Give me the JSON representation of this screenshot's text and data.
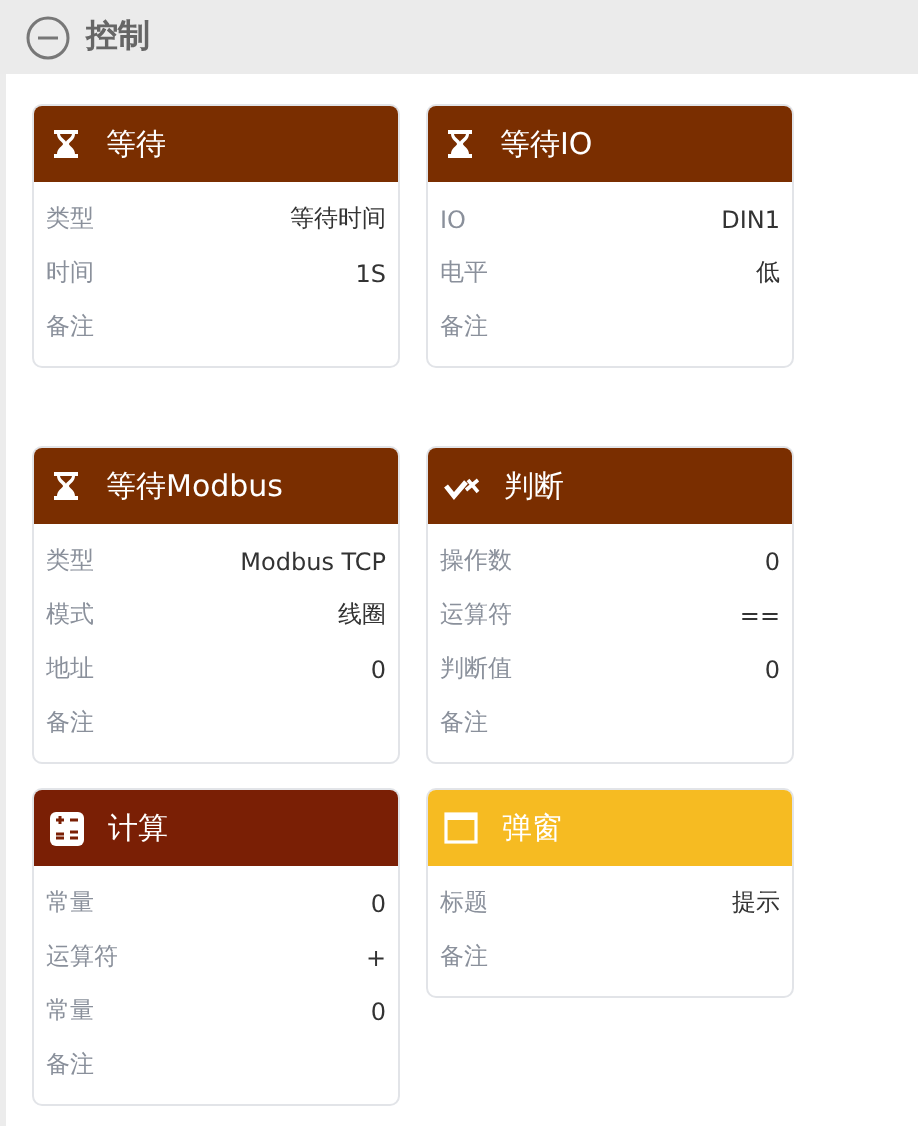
{
  "section": {
    "title": "控制",
    "expanded": true
  },
  "cards": [
    {
      "title": "等待",
      "kind": "wait",
      "color": "#7a2e00",
      "fields": [
        {
          "label": "类型",
          "value": "等待时间"
        },
        {
          "label": "时间",
          "value": "1S"
        },
        {
          "label": "备注"
        }
      ]
    },
    {
      "title": "等待IO",
      "kind": "wait",
      "color": "#7a2e00",
      "fields": [
        {
          "label": "IO",
          "value": "DIN1"
        },
        {
          "label": "电平",
          "value": "低"
        },
        {
          "label": "备注"
        }
      ]
    },
    {
      "title": "等待Modbus",
      "kind": "wait",
      "color": "#7a2e00",
      "fields": [
        {
          "label": "类型",
          "value": "Modbus TCP"
        },
        {
          "label": "模式",
          "value": "线圈"
        },
        {
          "label": "地址",
          "value": "0"
        },
        {
          "label": "备注"
        }
      ]
    },
    {
      "title": "判断",
      "kind": "judge",
      "color": "#7a2e00",
      "fields": [
        {
          "label": "操作数",
          "value": "0"
        },
        {
          "label": "运算符",
          "value": "=="
        },
        {
          "label": "判断值",
          "value": "0"
        },
        {
          "label": "备注"
        }
      ]
    },
    {
      "title": "计算",
      "kind": "calc",
      "color": "#7a1f05",
      "fields": [
        {
          "label": "常量",
          "value": "0"
        },
        {
          "label": "运算符",
          "value": "+"
        },
        {
          "label": "常量",
          "value": "0"
        },
        {
          "label": "备注"
        }
      ]
    },
    {
      "title": "弹窗",
      "kind": "popup",
      "color": "#f6bb22",
      "fields": [
        {
          "label": "标题",
          "value": "提示"
        },
        {
          "label": "备注"
        }
      ]
    }
  ]
}
